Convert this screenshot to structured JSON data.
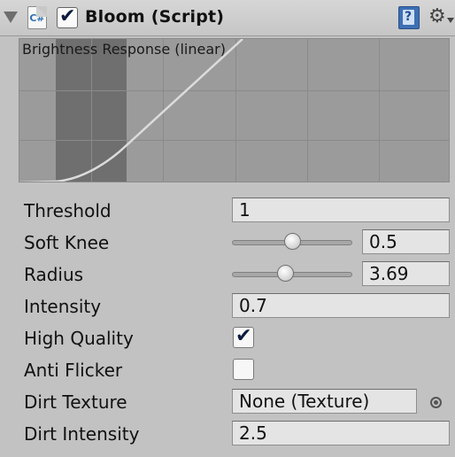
{
  "header": {
    "title": "Bloom (Script)",
    "script_icon_text": "C#",
    "enabled": true,
    "icons": {
      "fold": "fold-arrow-icon",
      "script": "csharp-script-icon",
      "help": "help-book-icon",
      "settings": "gear-icon"
    }
  },
  "graph": {
    "label": "Brightness Response (linear)"
  },
  "fields": {
    "threshold": {
      "label": "Threshold",
      "value": "1"
    },
    "soft_knee": {
      "label": "Soft Knee",
      "value": "0.5",
      "slider_fraction": 0.5
    },
    "radius": {
      "label": "Radius",
      "value": "3.69",
      "slider_fraction": 0.44
    },
    "intensity": {
      "label": "Intensity",
      "value": "0.7"
    },
    "high_quality": {
      "label": "High Quality",
      "checked": true
    },
    "anti_flicker": {
      "label": "Anti Flicker",
      "checked": false
    },
    "dirt_texture": {
      "label": "Dirt Texture",
      "value": "None (Texture)"
    },
    "dirt_intensity": {
      "label": "Dirt Intensity",
      "value": "2.5"
    }
  },
  "colors": {
    "panel_bg": "#c2c2c2",
    "graph_bg": "#9b9b9b",
    "knee_band": "#6f6f6f",
    "curve": "#dcdcdc"
  }
}
